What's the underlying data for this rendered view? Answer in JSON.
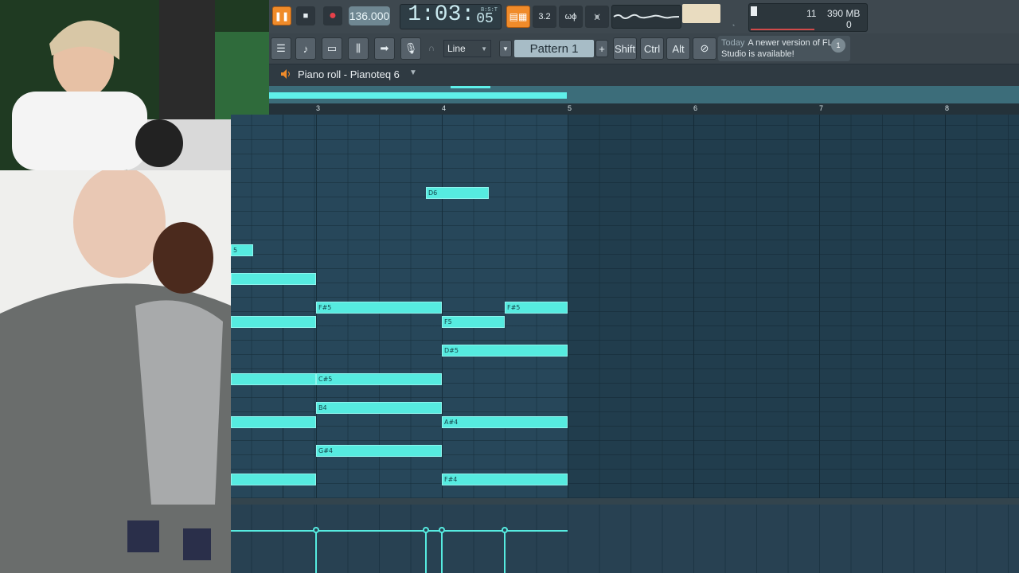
{
  "toolbar": {
    "bpm": "136.000",
    "time_main": "1:03:",
    "time_sub": "05",
    "time_label": "B:S:T",
    "cpu_value": "11",
    "memory": "390 MB",
    "polyphony": "0",
    "snap_value": "Line",
    "pattern_name": "Pattern 1",
    "modifier_shift": "Shift",
    "modifier_ctrl": "Ctrl",
    "modifier_alt": "Alt",
    "news_when": "Today",
    "news_text": "A newer version of FL Studio is available!",
    "news_count": "1"
  },
  "piano_roll": {
    "title": "Piano roll - Pianoteq 6",
    "bar_numbers": [
      "3",
      "4",
      "5",
      "6",
      "7",
      "8"
    ],
    "notes": [
      {
        "label": "D6"
      },
      {
        "label": "5"
      },
      {
        "label": ""
      },
      {
        "label": "F#5"
      },
      {
        "label": "F#5"
      },
      {
        "label": ""
      },
      {
        "label": "F5"
      },
      {
        "label": "D#5"
      },
      {
        "label": ""
      },
      {
        "label": "C#5"
      },
      {
        "label": "B4"
      },
      {
        "label": ""
      },
      {
        "label": "A#4"
      },
      {
        "label": "G#4"
      },
      {
        "label": ""
      },
      {
        "label": "F#4"
      }
    ]
  },
  "colors": {
    "note": "#56ebe0",
    "grid": "#27475a",
    "accent_orange": "#f08b2a"
  }
}
